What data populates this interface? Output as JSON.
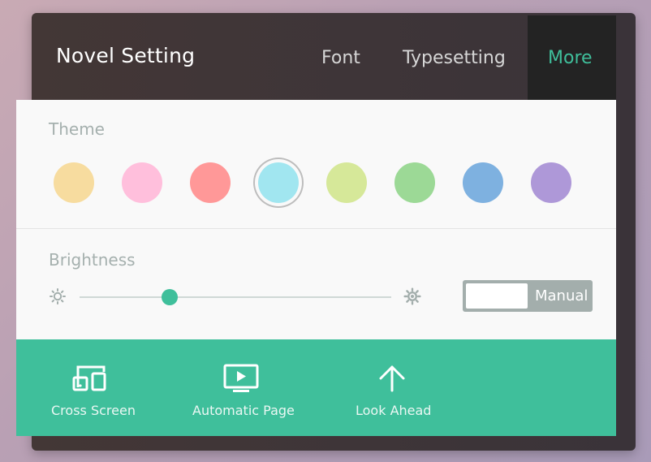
{
  "header": {
    "title": "Novel Setting",
    "tabs": [
      {
        "label": "Font",
        "active": false
      },
      {
        "label": "Typesetting",
        "active": false
      },
      {
        "label": "More",
        "active": true
      }
    ]
  },
  "theme": {
    "label": "Theme",
    "swatches": [
      {
        "color": "#f7dc9f",
        "selected": false
      },
      {
        "color": "#ffbfdc",
        "selected": false
      },
      {
        "color": "#ff9898",
        "selected": false
      },
      {
        "color": "#a1e6f0",
        "selected": true
      },
      {
        "color": "#d6e899",
        "selected": false
      },
      {
        "color": "#9cd996",
        "selected": false
      },
      {
        "color": "#7eb1e0",
        "selected": false
      },
      {
        "color": "#ae98d8",
        "selected": false
      }
    ]
  },
  "brightness": {
    "label": "Brightness",
    "level": 0.29,
    "mode_label": "Manual",
    "low_icon": "sun-low-icon",
    "high_icon": "sun-high-icon"
  },
  "footer": {
    "items": [
      {
        "label": "Cross Screen",
        "icon": "devices-icon"
      },
      {
        "label": "Automatic Page",
        "icon": "play-screen-icon"
      },
      {
        "label": "Look Ahead",
        "icon": "arrow-up-icon"
      }
    ]
  },
  "colors": {
    "accent": "#3fbf9b",
    "header_bg": "#3e3538",
    "active_tab_bg": "#232323",
    "card_bg": "#f9f9f9",
    "muted_text": "#a5b0ae"
  }
}
